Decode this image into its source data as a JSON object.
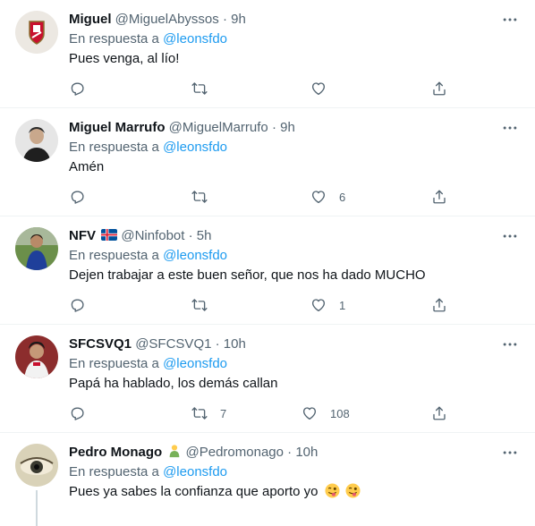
{
  "tweets": [
    {
      "name": "Miguel",
      "handle": "@MiguelAbyssos",
      "time": "9h",
      "reply_prefix": "En respuesta a",
      "reply_to": "@leonsfdo",
      "text": "Pues venga, al lío!",
      "stats": {
        "reply": "",
        "retweet": "",
        "like": ""
      }
    },
    {
      "name": "Miguel Marrufo",
      "handle": "@MiguelMarrufo",
      "time": "9h",
      "reply_prefix": "En respuesta a",
      "reply_to": "@leonsfdo",
      "text": "Amén",
      "stats": {
        "reply": "",
        "retweet": "",
        "like": "6"
      }
    },
    {
      "name": "NFV",
      "handle": "@Ninfobot",
      "time": "5h",
      "reply_prefix": "En respuesta a",
      "reply_to": "@leonsfdo",
      "text": "Dejen trabajar a este buen señor, que nos ha dado MUCHO",
      "stats": {
        "reply": "",
        "retweet": "",
        "like": "1"
      }
    },
    {
      "name": "SFCSVQ1",
      "handle": "@SFCSVQ1",
      "time": "10h",
      "reply_prefix": "En respuesta a",
      "reply_to": "@leonsfdo",
      "text": "Papá ha hablado, los demás callan",
      "stats": {
        "reply": "",
        "retweet": "7",
        "like": "108"
      }
    },
    {
      "name": "Pedro Monago",
      "handle": "@Pedromonago",
      "time": "10h",
      "reply_prefix": "En respuesta a",
      "reply_to": "@leonsfdo",
      "text": "Pues ya sabes la confianza que aporto yo"
    }
  ],
  "colors": {
    "accent": "#1d9bf0",
    "muted": "#536471",
    "text": "#0f1419"
  },
  "icons": [
    "more-icon",
    "reply-icon",
    "retweet-icon",
    "like-icon",
    "share-icon",
    "iceland-flag-icon",
    "person-emoji-icon",
    "winking-tongue-emoji-icon"
  ]
}
